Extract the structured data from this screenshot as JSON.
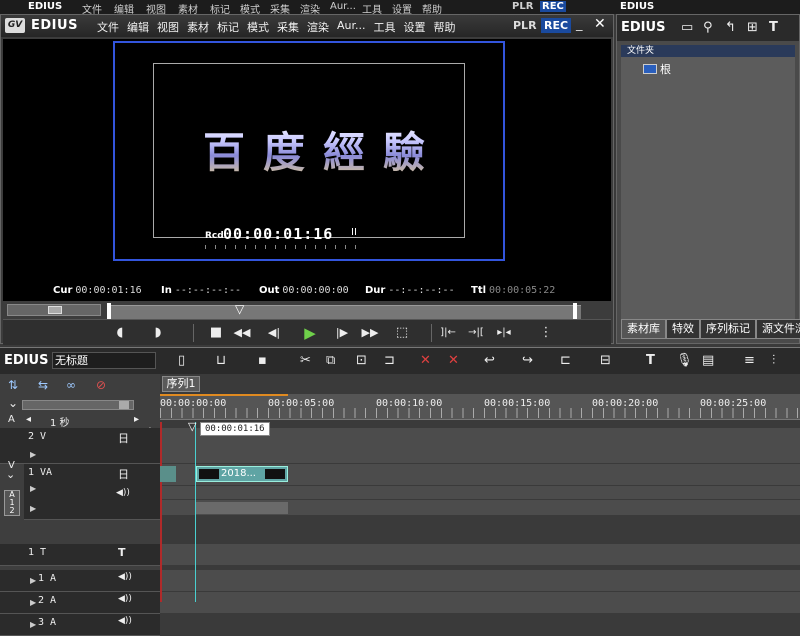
{
  "bg_strip": {
    "logo": "EDIUS",
    "menu": [
      "文件",
      "编辑",
      "视图",
      "素材",
      "标记",
      "模式",
      "采集",
      "渲染",
      "Aur...",
      "工具",
      "设置",
      "帮助"
    ],
    "right_logo": "EDIUS",
    "plr": "PLR",
    "rec": "REC"
  },
  "player": {
    "logo_badge": "GV",
    "app": "EDIUS",
    "menu": [
      "文件",
      "编辑",
      "视图",
      "素材",
      "标记",
      "模式",
      "采集",
      "渲染",
      "Aur...",
      "工具",
      "设置",
      "帮助"
    ],
    "plr": "PLR",
    "rec": "REC",
    "minimize": "_",
    "close": "✕",
    "title_overlay": "百度經驗",
    "rcd_label": "Rcd",
    "rcd_time": "00:00:01:16",
    "rcd_pause": "II",
    "timecodes": {
      "cur_label": "Cur",
      "cur": "00:00:01:16",
      "in_label": "In",
      "in": "--:--:--:--",
      "out_label": "Out",
      "out": "00:00:00:00",
      "dur_label": "Dur",
      "dur": "--:--:--:--",
      "ttl_label": "Ttl",
      "ttl": "00:00:05:22"
    },
    "transport": {
      "mark_in": "◖",
      "mark_out": "◗",
      "stop": "■",
      "rewind": "◀◀",
      "step_back": "◀|",
      "play": "▶",
      "step_fwd": "|▶",
      "ffwd": "▶▶",
      "loop": "⬚",
      "set_in": "]|←",
      "set_out": "→|[",
      "split": "▸|◂",
      "output": "⋮"
    }
  },
  "bin": {
    "title": "EDIUS",
    "icons": [
      "folder-icon",
      "search-icon",
      "up-icon",
      "add-icon",
      "text-icon"
    ],
    "folder_header": "文件夹",
    "root_label": "根",
    "tabs": [
      "素材库",
      "特效",
      "序列标记",
      "源文件浏"
    ]
  },
  "timeline": {
    "title": "EDIUS",
    "sequence_name": "无标题",
    "zoom_label": "1 秒",
    "sequence_tab": "序列1",
    "ruler": [
      "00:00:00:00",
      "00:00:05:00",
      "00:00:10:00",
      "00:00:15:00",
      "00:00:20:00",
      "00:00:25:00"
    ],
    "playhead_time": "00:00:01:16",
    "clip_label": "2018...",
    "tracks": [
      {
        "name": "2 V",
        "icon": "日"
      },
      {
        "name": "1 VA",
        "icon": "日",
        "audio_icon": "◀))"
      },
      {
        "name": "1 T",
        "icon": "T"
      },
      {
        "name": "1 A",
        "icon": "◀))"
      },
      {
        "name": "2 A",
        "icon": "◀))"
      },
      {
        "name": "3 A",
        "icon": "◀))"
      }
    ],
    "a12_label_a": "A",
    "a12_label_n": "1",
    "a12_label_d": "2",
    "v_label": "V",
    "a_label": "A",
    "arrow_right": "▶"
  }
}
